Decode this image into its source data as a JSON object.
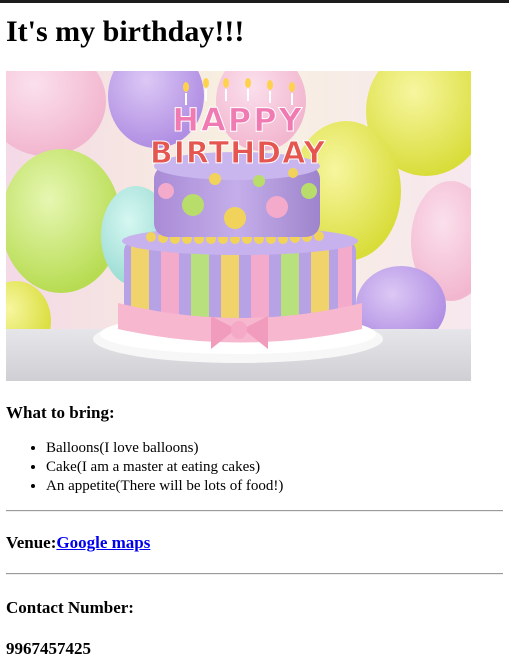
{
  "page": {
    "title": "It's my birthday!!!"
  },
  "hero_image": {
    "icon": "birthday-cake-image",
    "candle_text_line1": "HAPPY",
    "candle_text_line2": "BIRTHDAY"
  },
  "bring": {
    "heading": "What to bring:",
    "items": [
      "Balloons(I love balloons)",
      "Cake(I am a master at eating cakes)",
      "An appetite(There will be lots of food!)"
    ]
  },
  "venue": {
    "label": "Venue:",
    "link_text": "Google maps"
  },
  "contact": {
    "label": "Contact Number:",
    "number": "9967457425"
  },
  "colors": {
    "link": "#0000ee",
    "top_border": "#1c1c1c"
  }
}
